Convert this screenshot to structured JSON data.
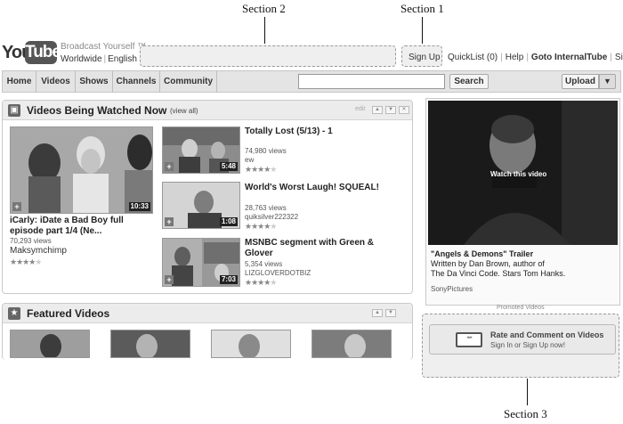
{
  "annotations": {
    "section1": "Section 1",
    "section2": "Section 2",
    "section3": "Section 3"
  },
  "header": {
    "logo_you": "You",
    "logo_tube": "Tube",
    "tagline": "Broadcast Yourself ™",
    "region": "Worldwide",
    "language": "English",
    "signup": "Sign Up",
    "quicklist": "QuickList (0)",
    "help": "Help",
    "goto": "Goto InternalTube",
    "signin": "Sign In"
  },
  "nav": {
    "tabs": [
      "Home",
      "Videos",
      "Shows",
      "Channels",
      "Community"
    ],
    "search_value": "",
    "search_button": "Search",
    "upload_button": "Upload",
    "upload_dropdown_icon": "triangle-down-icon"
  },
  "watched": {
    "title": "Videos Being Watched Now",
    "view_all": "(view all)",
    "control_text": "edit",
    "main": {
      "title": "iCarly: iDate a Bad Boy full episode part 1/4 (Ne...",
      "views": "70,293 views",
      "user": "Maksymchimp",
      "duration": "10:33",
      "rating": 4
    },
    "side": [
      {
        "title": "Totally Lost (5/13) - 1",
        "views": "74,980 views",
        "user": "ew",
        "duration": "5:48",
        "rating": 4
      },
      {
        "title": "World's Worst Laugh! SQUEAL!",
        "views": "28,763 views",
        "user": "quiksilver222322",
        "duration": "1:08",
        "rating": 4
      },
      {
        "title": "MSNBC segment with Green & Glover",
        "views": "5,354 views",
        "user": "LIZGLOVERDOTBIZ",
        "duration": "7:03",
        "rating": 4
      }
    ]
  },
  "featured": {
    "title": "Featured Videos"
  },
  "promo": {
    "overlay": "Watch this video",
    "title": "\"Angels & Demons\" Trailer",
    "desc_line1": "Written by Dan Brown, author of",
    "desc_line2": "The Da Vinci Code. Stars Tom Hanks.",
    "channel": "SonyPictures",
    "promoted_label": "Promoted Videos"
  },
  "rate": {
    "line1": "Rate and Comment on Videos",
    "line2": "Sign In or Sign Up now!",
    "icon": "rating-stars-icon"
  },
  "colors": {
    "nav_bg": "#e4e4e4",
    "panel_head": "#ececec",
    "dashed_border": "#9a9a9a"
  }
}
